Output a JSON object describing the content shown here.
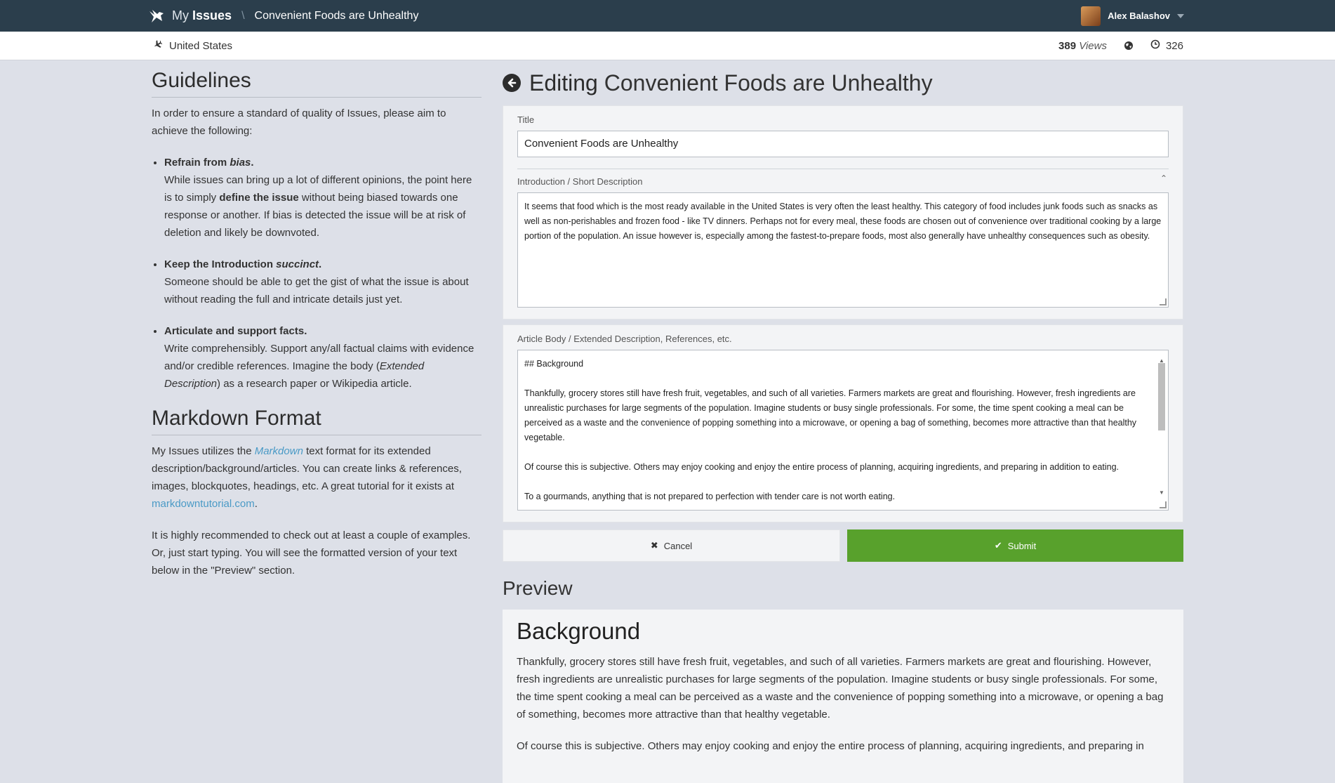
{
  "topbar": {
    "app_prefix": "My",
    "app_name": "Issues",
    "breadcrumb": "Convenient Foods are Unhealthy",
    "user_name": "Alex Balashov"
  },
  "subbar": {
    "location": "United States",
    "views_count": "389",
    "views_label": "Views",
    "score": "326"
  },
  "guidelines": {
    "title": "Guidelines",
    "intro": "In order to ensure a standard of quality of Issues, please aim to achieve the following:",
    "items": [
      {
        "head_a": "Refrain from ",
        "head_b": "bias",
        "head_c": ".",
        "body_a": "While issues can bring up a lot of different opinions, the point here is to simply ",
        "body_b": "define the issue",
        "body_c": " without being biased towards one response or another. If bias is detected the issue will be at risk of deletion and likely be downvoted."
      },
      {
        "head_a": "Keep the Introduction ",
        "head_b": "succinct",
        "head_c": ".",
        "body": "Someone should be able to get the gist of what the issue is about without reading the full and intricate details just yet."
      },
      {
        "head": "Articulate and support facts.",
        "body_a": "Write comprehensibly. Support any/all factual claims with evidence and/or credible references. Imagine the body (",
        "body_b": "Extended Description",
        "body_c": ") as a research paper or Wikipedia article."
      }
    ]
  },
  "markdown": {
    "title": "Markdown Format",
    "p1_a": "My Issues utilizes the ",
    "p1_link": "Markdown",
    "p1_b": " text format for its extended description/background/articles. You can create links & references, images, blockquotes, headings, etc. A great tutorial for it exists at ",
    "p1_link2": "markdowntutorial.com",
    "p1_c": ".",
    "p2": "It is highly recommended to check out at least a couple of examples. Or, just start typing. You will see the formatted version of your text below in the \"Preview\" section."
  },
  "editor": {
    "heading_bold": "Editing",
    "heading_title": "Convenient Foods are Unhealthy",
    "title_label": "Title",
    "title_value": "Convenient Foods are Unhealthy",
    "intro_label": "Introduction / Short Description",
    "intro_value": "It seems that food which is the most ready available in the United States is very often the least healthy. This category of food includes junk foods such as snacks as well as non-perishables and frozen food - like TV dinners. Perhaps not for every meal, these foods are chosen out of convenience over traditional cooking by a large portion of the population. An issue however is, especially among the fastest-to-prepare foods, most also generally have unhealthy consequences such as obesity.",
    "body_label": "Article Body / Extended Description, References, etc.",
    "body_lines": [
      "## Background",
      "Thankfully, grocery stores still have fresh fruit, vegetables, and such of all varieties. Farmers markets are great and flourishing. However, fresh ingredients are unrealistic purchases for large segments of the population. Imagine students or busy single professionals. For some, the time spent cooking a meal can be perceived as a waste and the convenience of popping something into a microwave, or opening a bag of something, becomes more attractive than that healthy vegetable.",
      "Of course this is subjective. Others may enjoy cooking and enjoy the entire process of planning, acquiring ingredients, and preparing in addition to eating.",
      "To a gourmands, anything that is not prepared to perfection with tender care is not worth eating."
    ],
    "cancel_label": "Cancel",
    "submit_label": "Submit"
  },
  "preview": {
    "title": "Preview",
    "h1": "Background",
    "p1": "Thankfully, grocery stores still have fresh fruit, vegetables, and such of all varieties. Farmers markets are great and flourishing. However, fresh ingredients are unrealistic purchases for large segments of the population. Imagine students or busy single professionals. For some, the time spent cooking a meal can be perceived as a waste and the convenience of popping something into a microwave, or opening a bag of something, becomes more attractive than that healthy vegetable.",
    "p2": "Of course this is subjective. Others may enjoy cooking and enjoy the entire process of planning, acquiring ingredients, and preparing in"
  }
}
